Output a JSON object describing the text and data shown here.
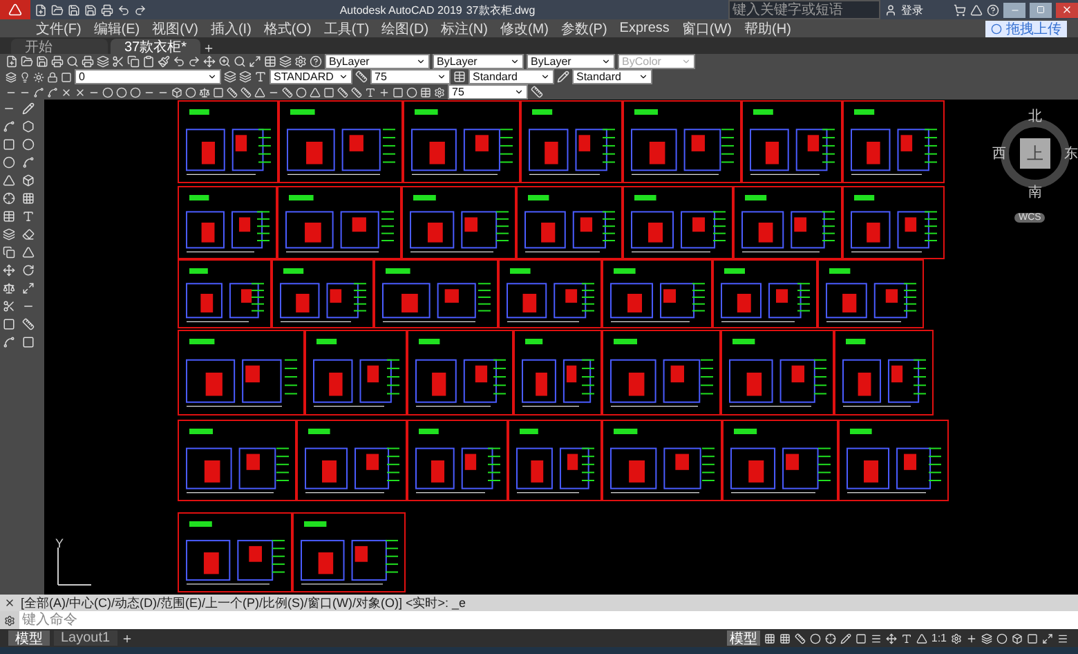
{
  "window": {
    "title": "Autodesk AutoCAD 2019",
    "file": "37款衣柜.dwg",
    "search": {
      "placeholder": "键入关键字或短语"
    },
    "user": "登录"
  },
  "menu": [
    "文件(F)",
    "编辑(E)",
    "视图(V)",
    "插入(I)",
    "格式(O)",
    "工具(T)",
    "绘图(D)",
    "标注(N)",
    "修改(M)",
    "参数(P)",
    "Express",
    "窗口(W)",
    "帮助(H)"
  ],
  "upload_button": "拖拽上传",
  "doc_tabs": [
    {
      "label": "开始",
      "selected": false
    },
    {
      "label": "37款衣柜*",
      "selected": true
    }
  ],
  "toolbar": {
    "color_setting": "ByLayer",
    "linetype": "ByLayer",
    "lineweight": "ByLayer",
    "plotstyle": "ByColor",
    "layer": "0",
    "text_style": "STANDARD",
    "dim_scale": "75",
    "dim_style": "Standard",
    "table_style": "Standard",
    "multileader_scale": "75"
  },
  "viewcube": {
    "north": "北",
    "east": "东",
    "south": "南",
    "west": "西",
    "face": "上",
    "ucs": "WCS"
  },
  "ucs_axis": "Y",
  "command": {
    "history": "[全部(A)/中心(C)/动态(D)/范围(E)/上一个(P)/比例(S)/窗口(W)/对象(O)] <实时>: _e",
    "placeholder": "键入命令"
  },
  "layout_tabs": [
    {
      "label": "模型",
      "selected": true
    },
    {
      "label": "Layout1",
      "selected": false
    }
  ],
  "status": {
    "space": "模型",
    "scale": "1:1"
  }
}
